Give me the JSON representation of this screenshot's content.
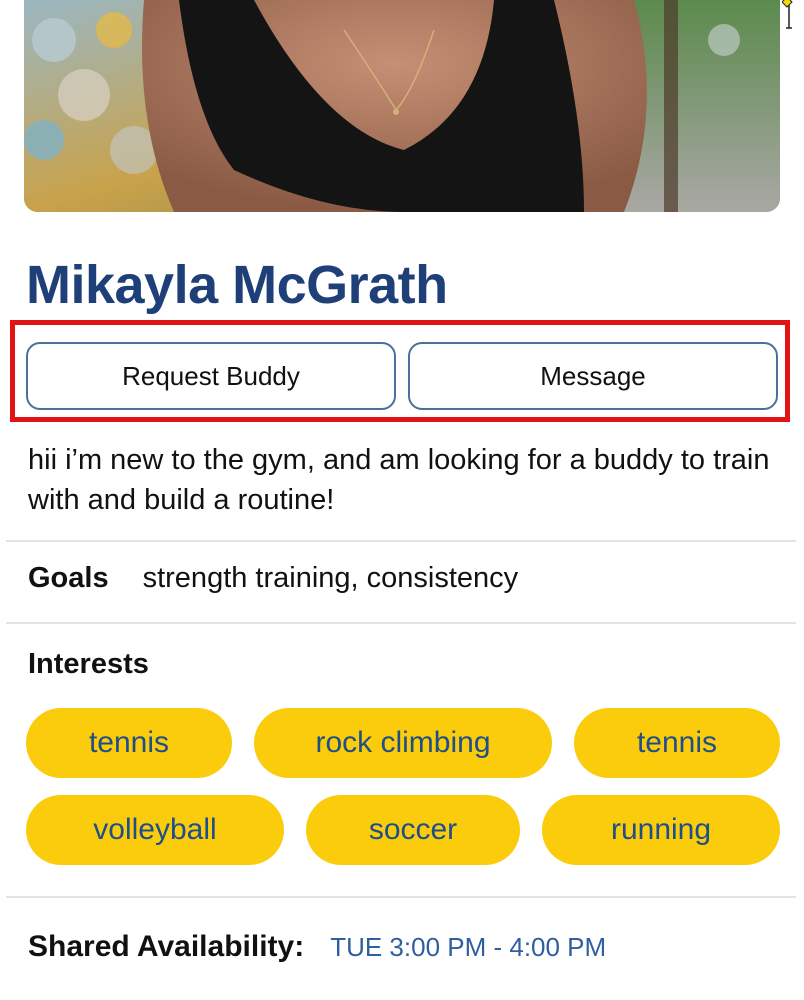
{
  "profile": {
    "name": "Mikayla McGrath",
    "bio": "hii i’m new to the gym, and am looking for a buddy to train with and build a routine!"
  },
  "actions": {
    "request_label": "Request Buddy",
    "message_label": "Message"
  },
  "goals": {
    "label": "Goals",
    "value": "strength training, consistency"
  },
  "interests": {
    "label": "Interests",
    "items": [
      "tennis",
      "rock climbing",
      "tennis",
      "volleyball",
      "soccer",
      "running"
    ]
  },
  "availability": {
    "label": "Shared Availability:",
    "value": "TUE 3:00 PM - 4:00 PM"
  },
  "colors": {
    "name": "#1f3f78",
    "chip_bg": "#fbcc0c",
    "chip_text": "#1f4f88",
    "highlight": "#e01414",
    "availability_value": "#2f5f9f"
  },
  "icons": {
    "profile_photo": "profile-photo",
    "cursor": "text-cursor-icon"
  }
}
